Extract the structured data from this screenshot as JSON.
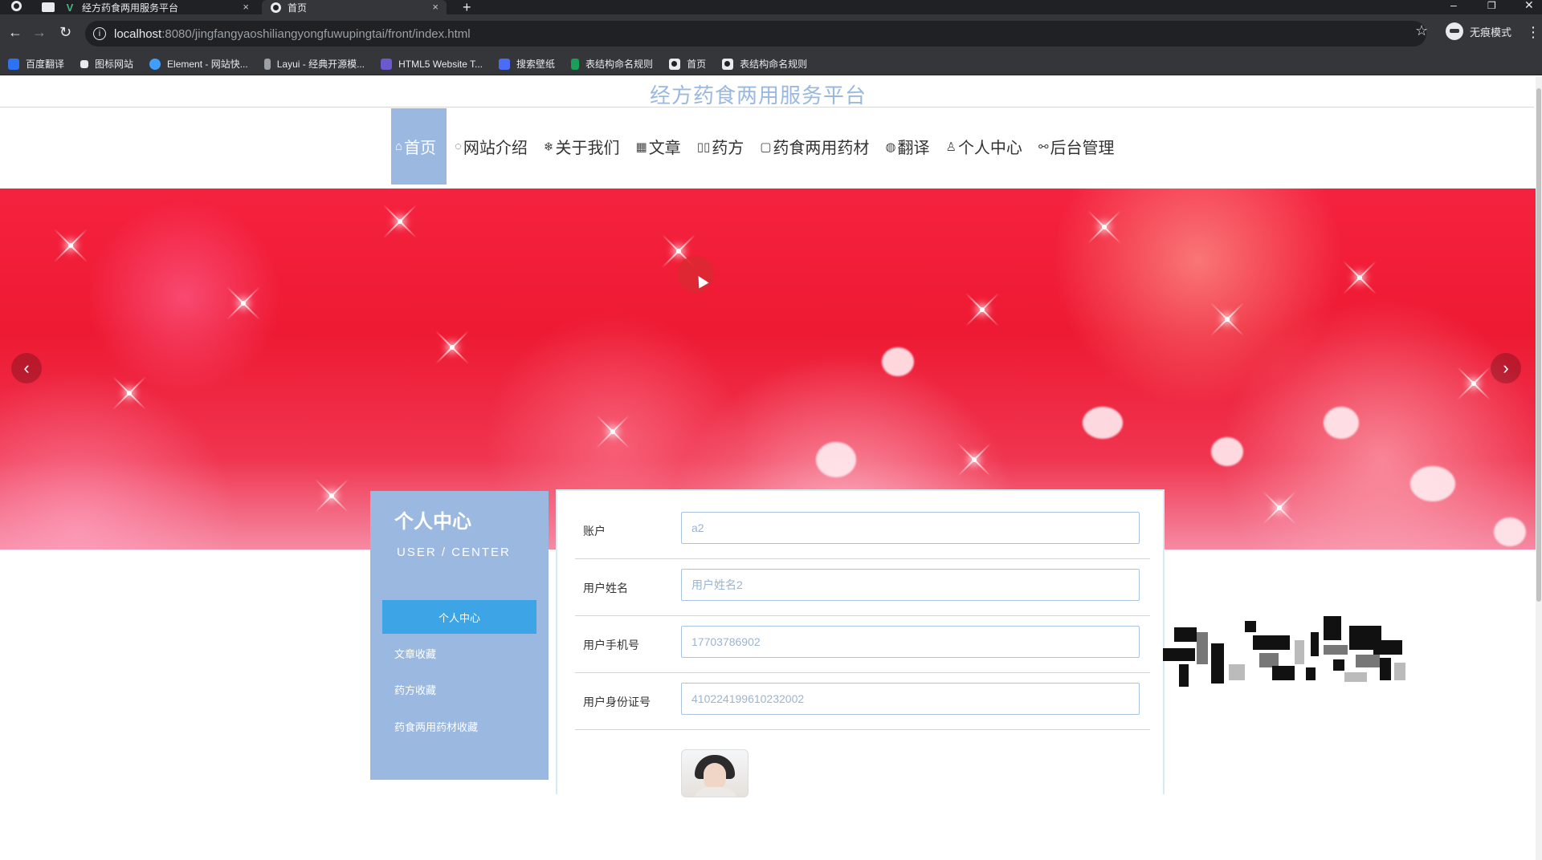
{
  "browser": {
    "tabs": [
      {
        "title": "经方药食两用服务平台",
        "close": "×"
      },
      {
        "title": "首页",
        "close": "×"
      }
    ],
    "new_tab": "+",
    "window_controls": {
      "minimize": "–",
      "restore": "❐",
      "close": "✕"
    },
    "nav": {
      "back": "←",
      "forward": "→",
      "reload": "↻"
    },
    "url_host": "localhost",
    "url_rest": ":8080/jingfangyaoshiliangyongfuwupingtai/front/index.html",
    "profile_label": "无痕模式",
    "bookmarks": [
      {
        "label": "百度翻译",
        "color": "#2d72f0"
      },
      {
        "label": "图标网站",
        "color": "#e8eaed"
      },
      {
        "label": "Element - 网站快...",
        "color": "#409eff"
      },
      {
        "label": "Layui - 经典开源模...",
        "color": "#9aa0a6"
      },
      {
        "label": "HTML5 Website T...",
        "color": "#6a5acd"
      },
      {
        "label": "搜索壁纸",
        "color": "#4a6cf7"
      },
      {
        "label": "表结构命名规则",
        "color": "#18a058"
      },
      {
        "label": "首页",
        "color": "#e8eaed"
      },
      {
        "label": "表结构命名规则",
        "color": "#e8eaed"
      }
    ]
  },
  "site": {
    "title": "经方药食两用服务平台",
    "accent": "#9ab8e0",
    "nav": [
      {
        "icon": "⌂",
        "label": "首页",
        "active": true
      },
      {
        "icon": "◌",
        "label": "网站介绍"
      },
      {
        "icon": "❄",
        "label": "关于我们"
      },
      {
        "icon": "▦",
        "label": "文章"
      },
      {
        "icon": "▯▯",
        "label": "药方"
      },
      {
        "icon": "▢",
        "label": "药食两用药材"
      },
      {
        "icon": "◍",
        "label": "翻译"
      },
      {
        "icon": "♙",
        "label": "个人中心"
      },
      {
        "icon": "⚯",
        "label": "后台管理"
      }
    ],
    "carousel": {
      "prev": "‹",
      "next": "›",
      "slides": 3,
      "active_slide": 1
    }
  },
  "sidebar": {
    "title": "个人中心",
    "subtitle": "USER / CENTER",
    "items": [
      {
        "label": "个人中心",
        "active": true
      },
      {
        "label": "文章收藏"
      },
      {
        "label": "药方收藏"
      },
      {
        "label": "药食两用药材收藏"
      }
    ]
  },
  "form": {
    "fields": [
      {
        "label": "账户",
        "value": "a2"
      },
      {
        "label": "用户姓名",
        "value": "用户姓名2"
      },
      {
        "label": "用户手机号",
        "value": "17703786902"
      },
      {
        "label": "用户身份证号",
        "value": "410224199610232002"
      }
    ]
  }
}
